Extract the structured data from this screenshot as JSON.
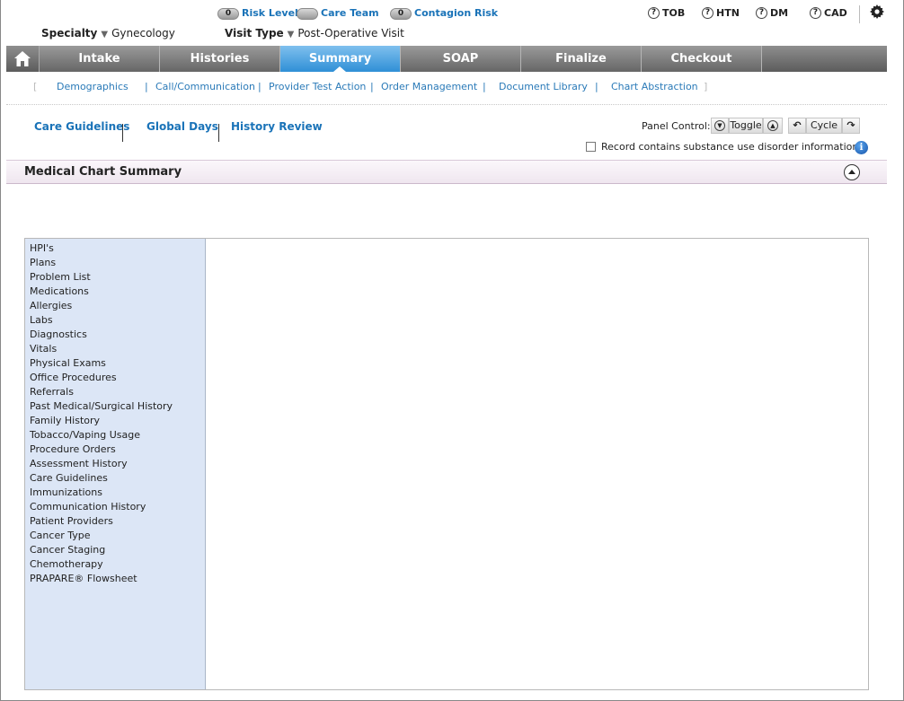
{
  "header": {
    "indicators": [
      {
        "count": "0",
        "label": "Risk Level"
      },
      {
        "count": "",
        "label": "Care Team"
      },
      {
        "count": "0",
        "label": "Contagion Risk"
      }
    ],
    "help_items": [
      {
        "label": "TOB"
      },
      {
        "label": "HTN"
      },
      {
        "label": "DM"
      },
      {
        "label": "CAD"
      }
    ],
    "specialty_label": "Specialty",
    "specialty_value": "Gynecology",
    "visit_type_label": "Visit Type",
    "visit_type_value": "Post-Operative Visit"
  },
  "nav": {
    "tabs": [
      {
        "label": "Intake"
      },
      {
        "label": "Histories"
      },
      {
        "label": "Summary"
      },
      {
        "label": "SOAP"
      },
      {
        "label": "Finalize"
      },
      {
        "label": "Checkout"
      }
    ],
    "active_tab": "Summary"
  },
  "subnav": {
    "items": [
      {
        "label": "Demographics"
      },
      {
        "label": "Call/Communication"
      },
      {
        "label": "Provider Test Action"
      },
      {
        "label": "Order Management"
      },
      {
        "label": "Document Library"
      },
      {
        "label": "Chart Abstraction"
      }
    ]
  },
  "secondary": {
    "links": [
      {
        "label": "Care Guidelines"
      },
      {
        "label": "Global Days"
      },
      {
        "label": "History Review"
      }
    ],
    "panel_control_label": "Panel Control:",
    "toggle_label": "Toggle",
    "cycle_label": "Cycle",
    "substance_checkbox_label": "Record contains substance use disorder information",
    "substance_checked": false,
    "info_glyph": "i"
  },
  "section": {
    "title": "Medical Chart Summary"
  },
  "sidebar": {
    "items": [
      {
        "label": "HPI's"
      },
      {
        "label": "Plans"
      },
      {
        "label": "Problem List"
      },
      {
        "label": "Medications"
      },
      {
        "label": "Allergies"
      },
      {
        "label": "Labs"
      },
      {
        "label": "Diagnostics"
      },
      {
        "label": "Vitals"
      },
      {
        "label": "Physical Exams"
      },
      {
        "label": "Office Procedures"
      },
      {
        "label": "Referrals"
      },
      {
        "label": "Past Medical/Surgical History"
      },
      {
        "label": "Family History"
      },
      {
        "label": "Tobacco/Vaping Usage"
      },
      {
        "label": "Procedure Orders"
      },
      {
        "label": "Assessment History"
      },
      {
        "label": "Care Guidelines"
      },
      {
        "label": "Immunizations"
      },
      {
        "label": "Communication History"
      },
      {
        "label": "Patient Providers"
      },
      {
        "label": "Cancer Type"
      },
      {
        "label": "Cancer Staging"
      },
      {
        "label": "Chemotherapy"
      },
      {
        "label": "PRAPARE® Flowsheet"
      }
    ]
  },
  "colors": {
    "link": "#1a73b8",
    "active_tab": "#2f8fd6",
    "sidebar_bg": "#dce6f6"
  }
}
